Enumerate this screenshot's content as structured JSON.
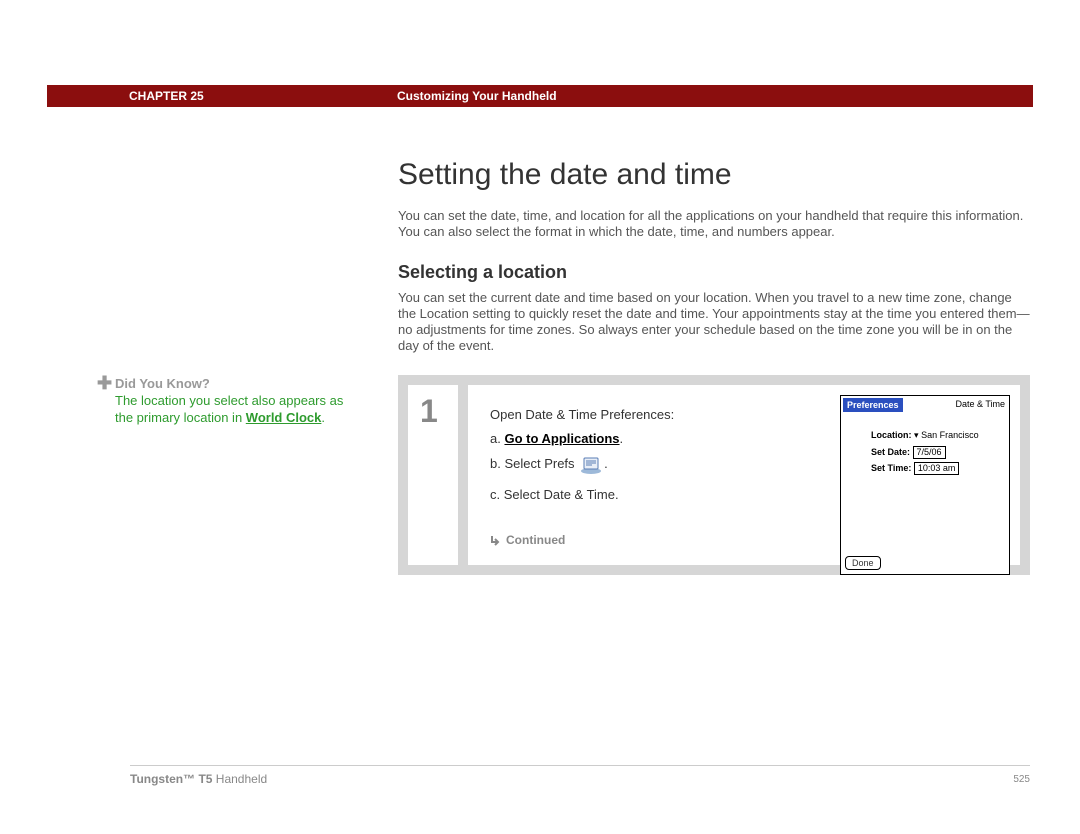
{
  "header": {
    "chapter": "CHAPTER 25",
    "section": "Customizing Your Handheld"
  },
  "h1": "Setting the date and time",
  "body1": "You can set the date, time, and location for all the applications on your handheld that require this information. You can also select the format in which the date, time, and numbers appear.",
  "h2": "Selecting a location",
  "body2": "You can set the current date and time based on your location. When you travel to a new time zone, change the Location setting to quickly reset the date and time. Your appointments stay at the time you entered them—no adjustments for time zones. So always enter your schedule based on the time zone you will be in on the day of the event.",
  "dyk": {
    "title": "Did You Know?",
    "text_pre": "The location you select also appears as the primary location in ",
    "link": "World Clock",
    "text_post": "."
  },
  "step": {
    "num": "1",
    "open": "Open Date & Time Preferences:",
    "a_prefix": "a.  ",
    "a_link": "Go to Applications",
    "a_suffix": ".",
    "b_prefix": "b.  Select Prefs ",
    "b_suffix": ".",
    "c": "c.  Select Date & Time.",
    "continued": "Continued"
  },
  "shot": {
    "prefs": "Preferences",
    "dt": "Date & Time",
    "loc_label": "Location:",
    "loc_val": "San Francisco",
    "date_label": "Set Date:",
    "date_val": "7/5/06",
    "time_label": "Set Time:",
    "time_val": "10:03 am",
    "done": "Done"
  },
  "footer": {
    "product_bold": "Tungsten™ T5",
    "product_rest": " Handheld",
    "page": "525"
  }
}
